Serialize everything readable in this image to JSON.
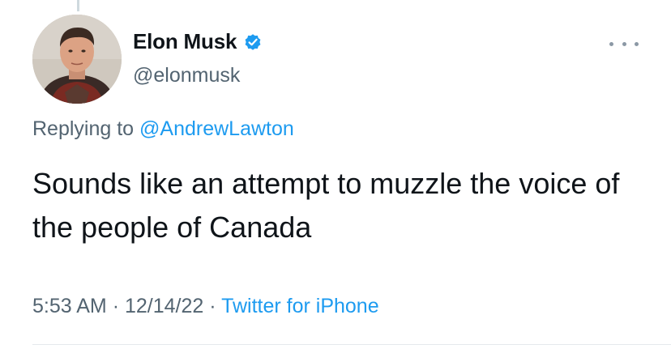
{
  "author": {
    "display_name": "Elon Musk",
    "handle": "@elonmusk",
    "verified": true,
    "avatar_icon": "profile-photo"
  },
  "reply_context": {
    "prefix": "Replying to",
    "mention": "@AndrewLawton"
  },
  "tweet": {
    "text": "Sounds like an attempt to muzzle the voice of the people of Canada"
  },
  "meta": {
    "time": "5:53 AM",
    "separator_1": "·",
    "date": "12/14/22",
    "separator_2": "·",
    "source": "Twitter for iPhone"
  },
  "colors": {
    "link": "#1d9bf0",
    "secondary_text": "#536471",
    "primary_text": "#0f1419",
    "verified_badge": "#1d9bf0"
  }
}
